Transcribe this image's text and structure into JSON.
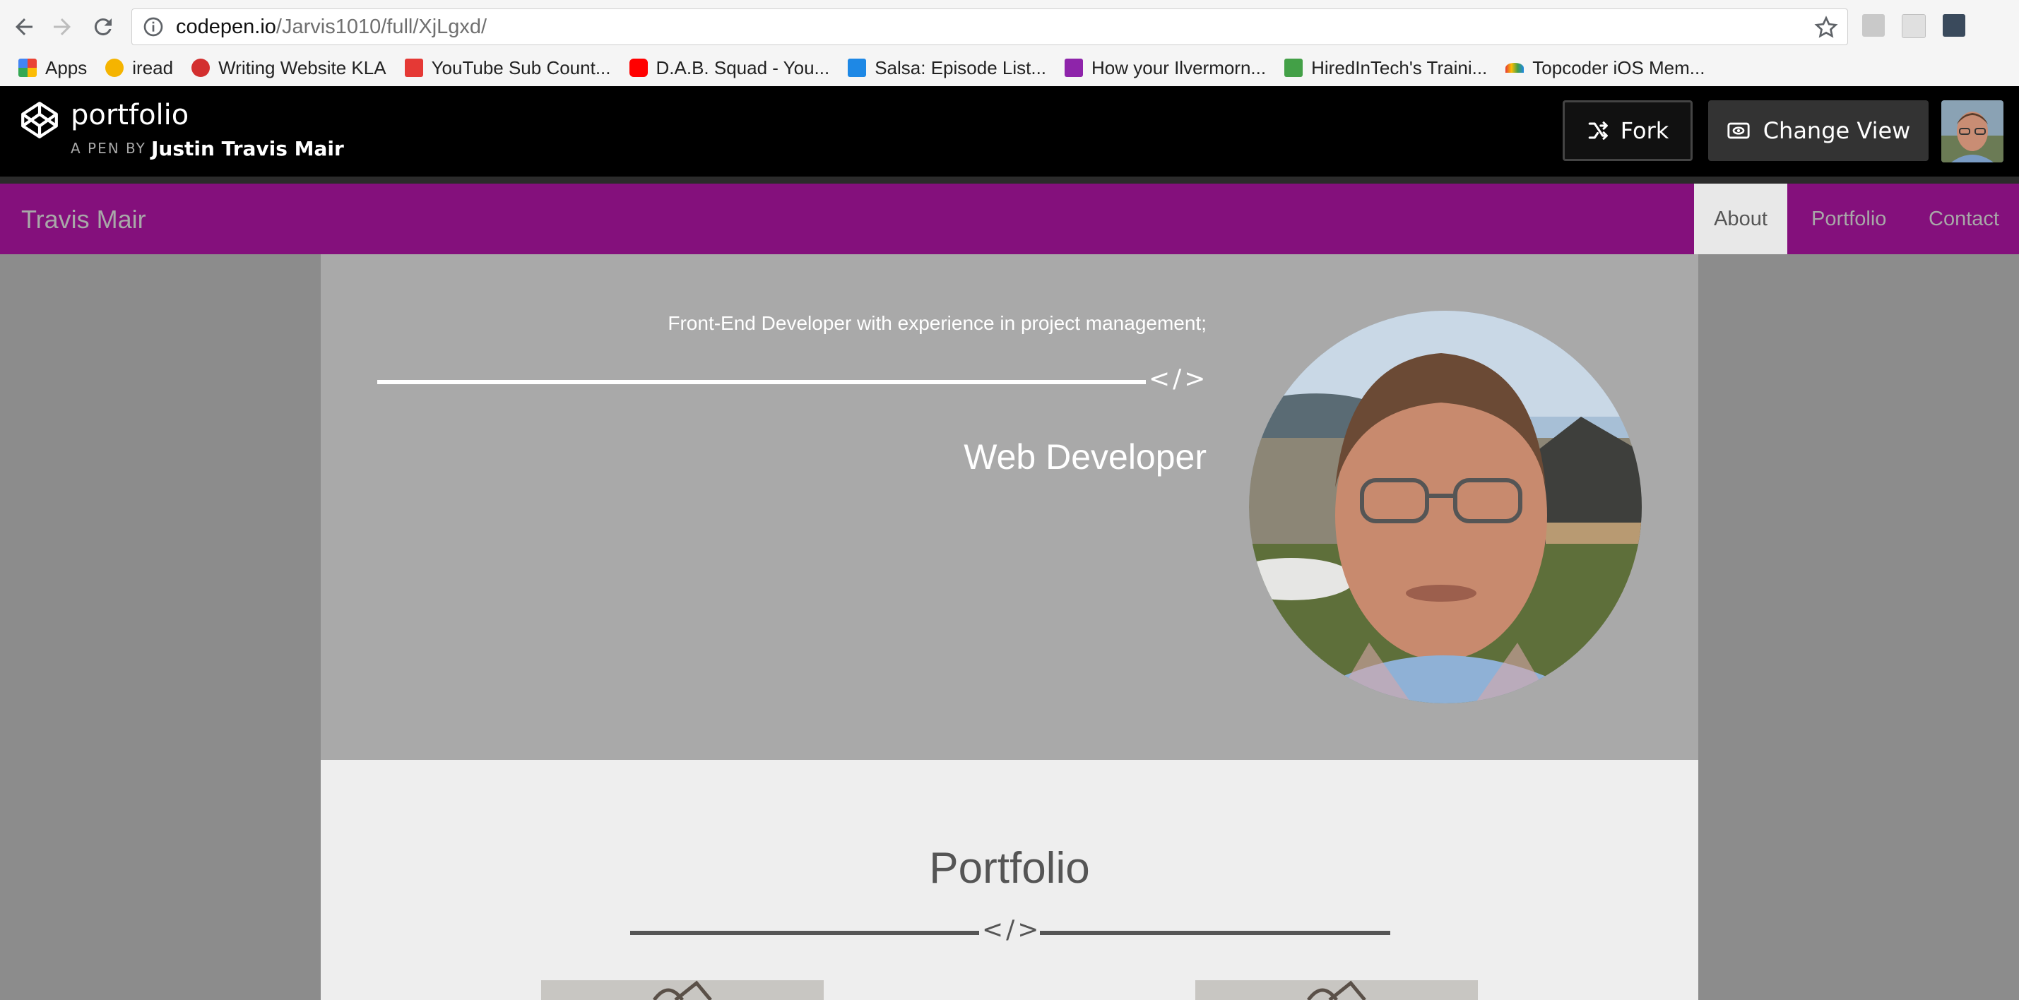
{
  "browser": {
    "url_host": "codepen.io",
    "url_path": "/Jarvis1010/full/XjLgxd/",
    "bookmarks": [
      {
        "label": "Apps",
        "icon": "apps-grid-icon",
        "color": "#4285f4"
      },
      {
        "label": "iread",
        "icon": "iread-icon",
        "color": "#f5b400"
      },
      {
        "label": "Writing Website KLA",
        "icon": "writing-icon",
        "color": "#d32f2f"
      },
      {
        "label": "YouTube Sub Count...",
        "icon": "youtube-sub-icon",
        "color": "#e53935"
      },
      {
        "label": "D.A.B. Squad - You...",
        "icon": "youtube-icon",
        "color": "#ff0000"
      },
      {
        "label": "Salsa: Episode List...",
        "icon": "salsa-icon",
        "color": "#1e88e5"
      },
      {
        "label": "How your Ilvermorn...",
        "icon": "hufflepuff-h-icon",
        "color": "#8e24aa"
      },
      {
        "label": "HiredInTech's Traini...",
        "icon": "hiredintech-icon",
        "color": "#43a047"
      },
      {
        "label": "Topcoder iOS Mem...",
        "icon": "topcoder-icon",
        "color": "#fb8c00"
      }
    ]
  },
  "codepen": {
    "title": "portfolio",
    "by": "A PEN BY",
    "author": "Justin Travis Mair",
    "fork_label": "Fork",
    "change_view_label": "Change View"
  },
  "site": {
    "brand": "Travis Mair",
    "nav": {
      "about": "About",
      "portfolio": "Portfolio",
      "contact": "Contact"
    },
    "accent_color": "#84107c"
  },
  "hero": {
    "tagline": "Front-End Developer with experience in project management;",
    "code_glyph": "</>",
    "title": "Web Developer"
  },
  "portfolio": {
    "title": "Portfolio",
    "code_glyph": "</>"
  }
}
